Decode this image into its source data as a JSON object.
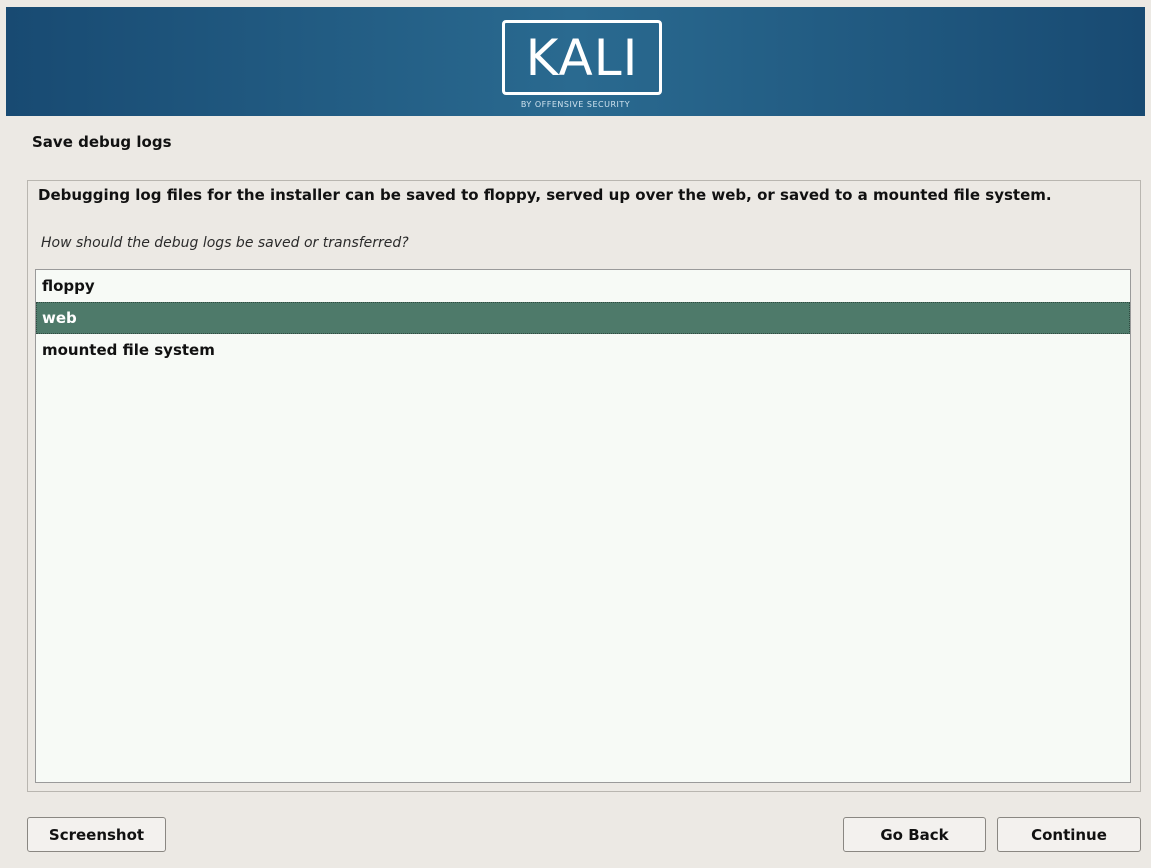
{
  "banner": {
    "logo_text": "KALI",
    "logo_subtitle": "BY OFFENSIVE SECURITY"
  },
  "step": {
    "title": "Save debug logs"
  },
  "content": {
    "description": "Debugging log files for the installer can be saved to floppy, served up over the web, or saved to a mounted file system.",
    "question": "How should the debug logs be saved or transferred?",
    "options": [
      {
        "label": "floppy",
        "selected": false
      },
      {
        "label": "web",
        "selected": true
      },
      {
        "label": "mounted file system",
        "selected": false
      }
    ],
    "selected_color": "#4e7a6a"
  },
  "buttons": {
    "screenshot": "Screenshot",
    "go_back": "Go Back",
    "continue": "Continue"
  },
  "colors": {
    "banner": "#184a72",
    "background": "#ece9e4",
    "list_background": "#f7faf6"
  }
}
